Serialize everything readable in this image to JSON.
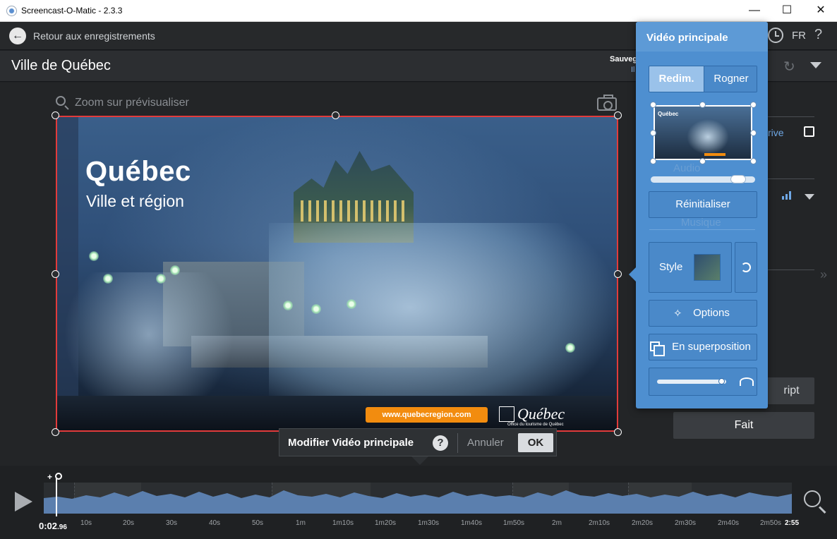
{
  "window": {
    "title": "Screencast-O-Matic - 2.3.3",
    "minimize": "—",
    "maximize": "☐",
    "close": "✕"
  },
  "nav": {
    "back_label": "Retour aux enregistrements",
    "language": "FR",
    "help": "?"
  },
  "project": {
    "title": "Ville de Québec",
    "autosave": "Sauvegardé automatiquement",
    "autosave_sub": "Il"
  },
  "preview": {
    "zoom_label": "Zoom sur prévisualiser",
    "heading": "Québec",
    "subheading": "Ville et région",
    "url": "www.quebecregion.com",
    "brand": "Québec",
    "brand_sub": "Office du tourisme de Québec"
  },
  "side": {
    "drive_fragment": "rive",
    "script_fragment": "ript",
    "done_label": "Fait"
  },
  "editbar": {
    "label": "Modifier Vidéo principale",
    "help": "?",
    "cancel_label": "Annuler",
    "ok_label": "OK"
  },
  "popover": {
    "title": "Vidéo principale",
    "resize_tab": "Redim.",
    "crop_tab": "Rogner",
    "thumb_text": "Québec",
    "ghost_audio": "Audio",
    "ghost_music": "Musique",
    "reset_label": "Réinitialiser",
    "style_label": "Style",
    "options_label": "Options",
    "overlay_label": "En superposition",
    "resize_slider": 0.9,
    "opacity_slider": 0.95
  },
  "timeline": {
    "current_time": "0:02",
    "current_time_frac": ".96",
    "end_time": "2:55",
    "ticks": [
      "10s",
      "20s",
      "30s",
      "40s",
      "50s",
      "1m",
      "1m10s",
      "1m20s",
      "1m30s",
      "1m40s",
      "1m50s",
      "2m",
      "2m10s",
      "2m20s",
      "2m30s",
      "2m40s",
      "2m50s"
    ]
  }
}
